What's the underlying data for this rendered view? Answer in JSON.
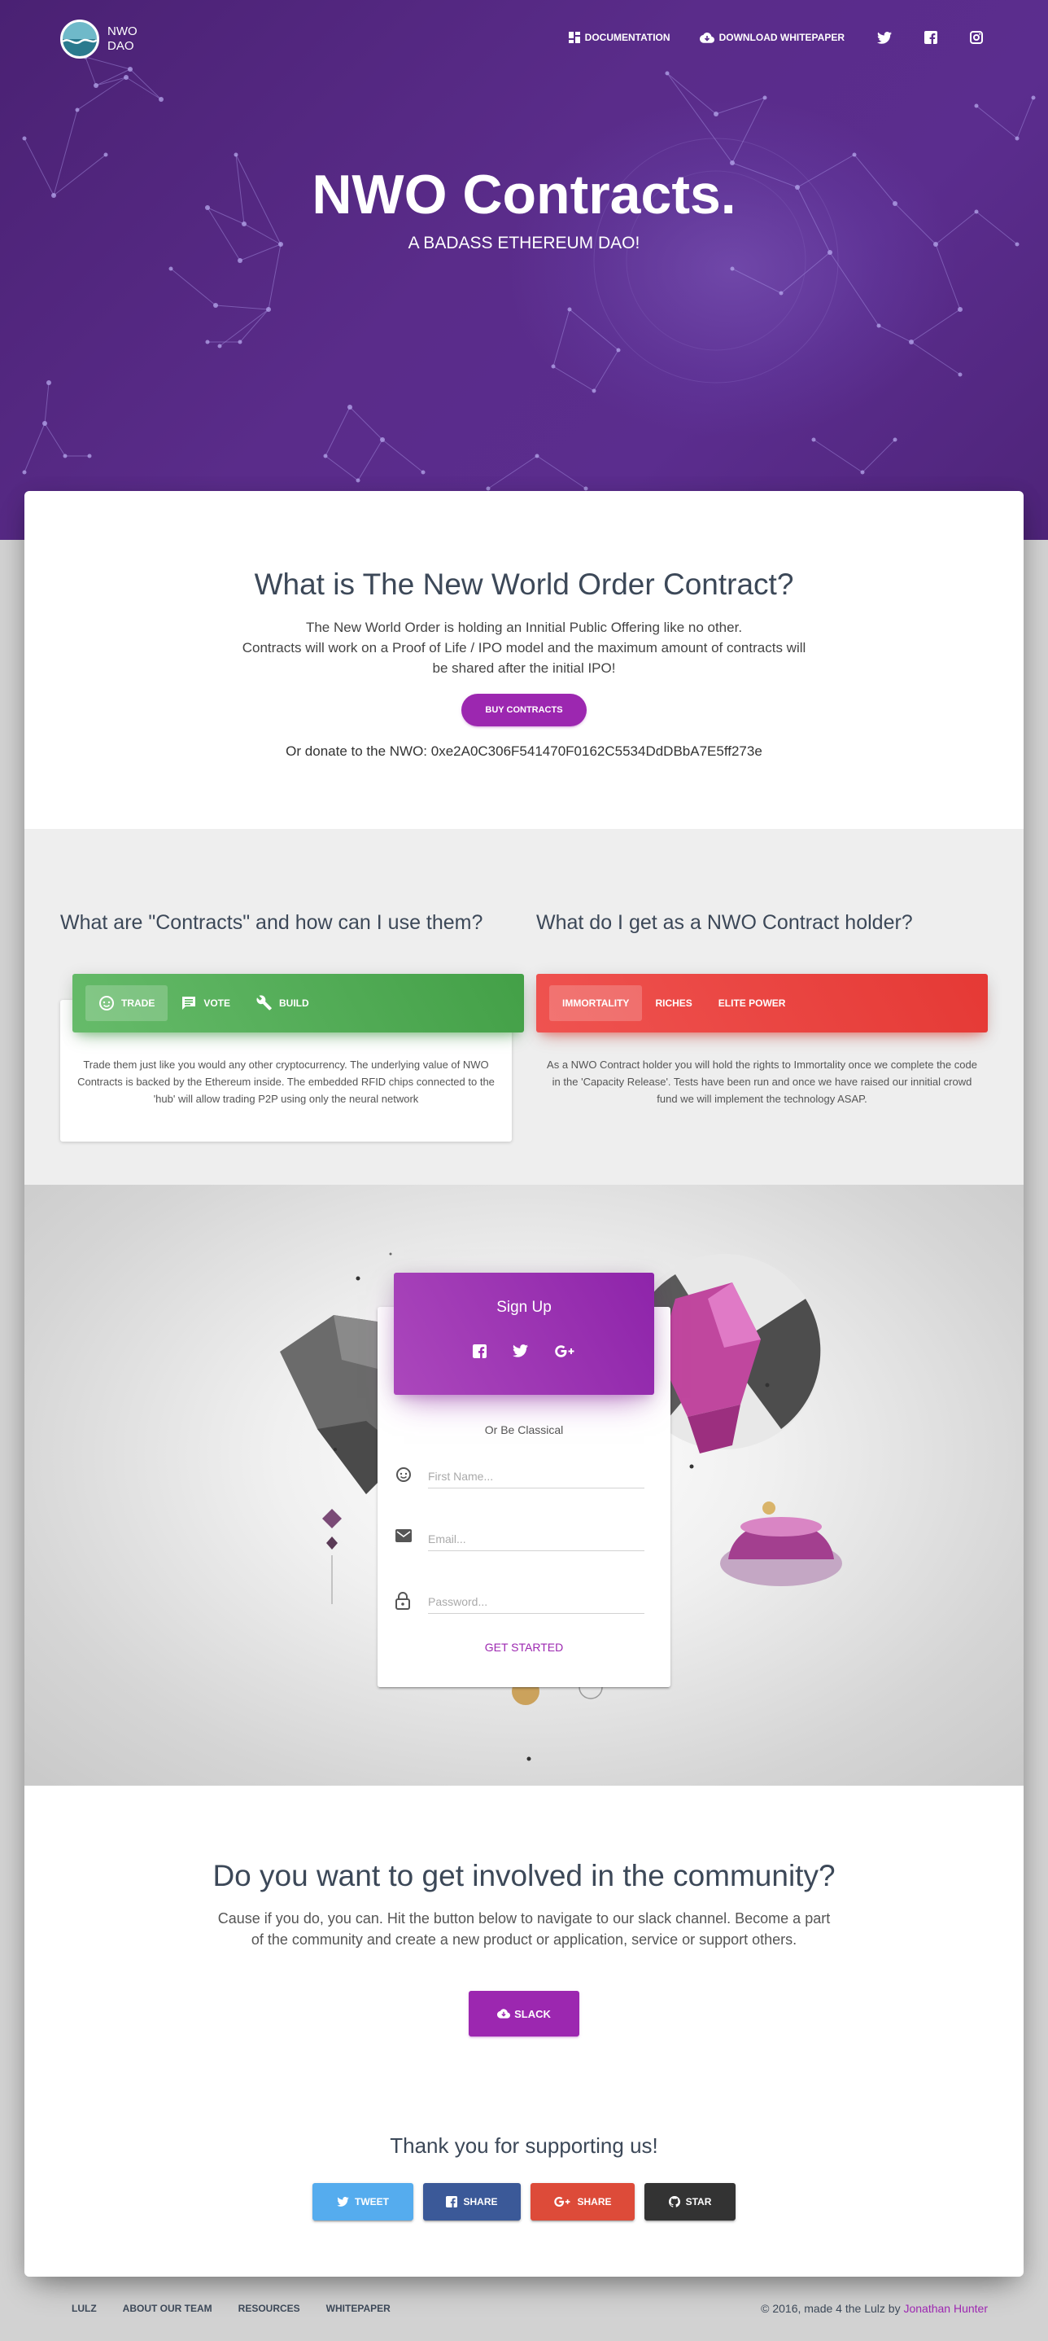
{
  "nav": {
    "logo_line1": "NWO",
    "logo_line2": "DAO",
    "documentation": "Documentation",
    "whitepaper": "Download Whitepaper",
    "social_icons": [
      "twitter-icon",
      "facebook-icon",
      "instagram-icon"
    ]
  },
  "hero": {
    "title": "NWO Contracts.",
    "subtitle": "A BADASS ETHEREUM DAO!"
  },
  "what": {
    "title": "What is The New World Order Contract?",
    "line1": "The New World Order is holding an Innitial Public Offering like no other.",
    "line2": "Contracts will work on a Proof of Life / IPO model and the maximum amount of contracts will",
    "line3": "be shared after the initial IPO!",
    "buy_button": "Buy Contracts",
    "donate": "Or donate to the NWO: 0xe2A0C306F541470F0162C5534DdDBbA7E5ff273e"
  },
  "contracts": {
    "title": "What are \"Contracts\" and how can I use them?",
    "tabs": [
      "Trade",
      "Vote",
      "Build"
    ],
    "active_tab": "Trade",
    "text": "Trade them just like you would any other cryptocurrency. The underlying value of NWO Contracts is backed by the Ethereum inside. The embedded RFID chips connected to the 'hub' will allow trading P2P using only the neural network"
  },
  "holder": {
    "title": "What do I get as a NWO Contract holder?",
    "tabs": [
      "Immortality",
      "Riches",
      "Elite Power"
    ],
    "active_tab": "Immortality",
    "text": "As a NWO Contract holder you will hold the rights to Immortality once we complete the code in the 'Capacity Release'. Tests have been run and once we have raised our innitial crowd fund we will implement the technology ASAP."
  },
  "signup": {
    "title": "Sign Up",
    "classical": "Or Be Classical",
    "first_name_placeholder": "First Name...",
    "email_placeholder": "Email...",
    "password_placeholder": "Password...",
    "submit": "Get Started"
  },
  "community": {
    "title": "Do you want to get involved in the community?",
    "line1": "Cause if you do, you can. Hit the button below to navigate to our slack channel. Become a part",
    "line2": "of the community and create a new product or application, service or support others.",
    "slack_button": "Slack",
    "thanks": "Thank you for supporting us!",
    "share_buttons": [
      {
        "label": "Tweet",
        "color": "#55acee",
        "icon": "twitter-icon"
      },
      {
        "label": "Share",
        "color": "#3b5998",
        "icon": "facebook-icon"
      },
      {
        "label": "Share",
        "color": "#dd4b39",
        "icon": "google-plus-icon"
      },
      {
        "label": "Star",
        "color": "#333333",
        "icon": "github-icon"
      }
    ]
  },
  "footer": {
    "links": [
      "Lulz",
      "About our team",
      "Resources",
      "Whitepaper"
    ],
    "copyright_prefix": "© 2016, made 4 the Lulz by",
    "author": "Jonathan Hunter"
  },
  "colors": {
    "primary": "#9c27b0",
    "hero": "#5a2c8a",
    "success": "#4caf50",
    "danger": "#f44336"
  }
}
